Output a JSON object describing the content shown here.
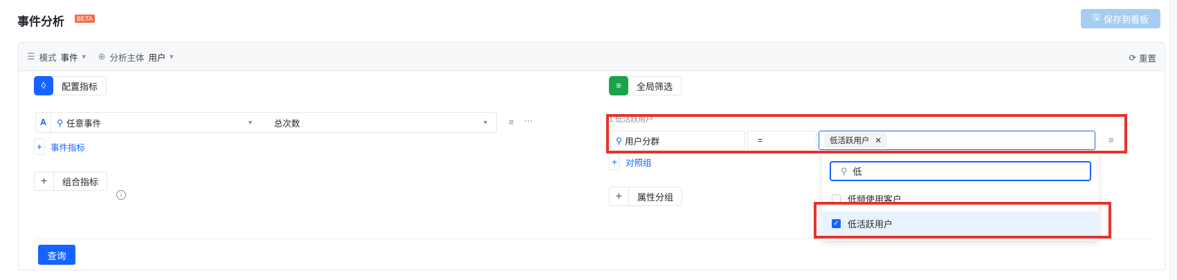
{
  "header": {
    "title": "事件分析",
    "badge": "BETA",
    "save_label": "保存到看板"
  },
  "toolbar": {
    "mode_label": "模式",
    "mode_value": "事件",
    "subject_label": "分析主体",
    "subject_value": "用户",
    "reset_label": "重置"
  },
  "metrics": {
    "section_label": "配置指标",
    "row_letter": "A",
    "event_value": "任意事件",
    "measure_value": "总次数",
    "add_event_metric": "事件指标",
    "combo_metric": "组合指标"
  },
  "filters": {
    "section_label": "全局筛选",
    "filter_name": "1.低活跃用户",
    "field": "用户分群",
    "operator": "=",
    "selected_tag": "低活跃用户",
    "add_compare_group": "对照组",
    "property_group": "属性分组"
  },
  "dropdown": {
    "search_value": "低",
    "options": [
      {
        "label": "低频使用客户",
        "checked": false
      },
      {
        "label": "低活跃用户",
        "checked": true
      }
    ]
  },
  "actions": {
    "query_label": "查询"
  },
  "colors": {
    "primary": "#1664ff",
    "highlight": "#e5332a",
    "beta": "#f76b45",
    "metric_icon": "#1664ff",
    "filter_icon": "#1aa34a"
  }
}
